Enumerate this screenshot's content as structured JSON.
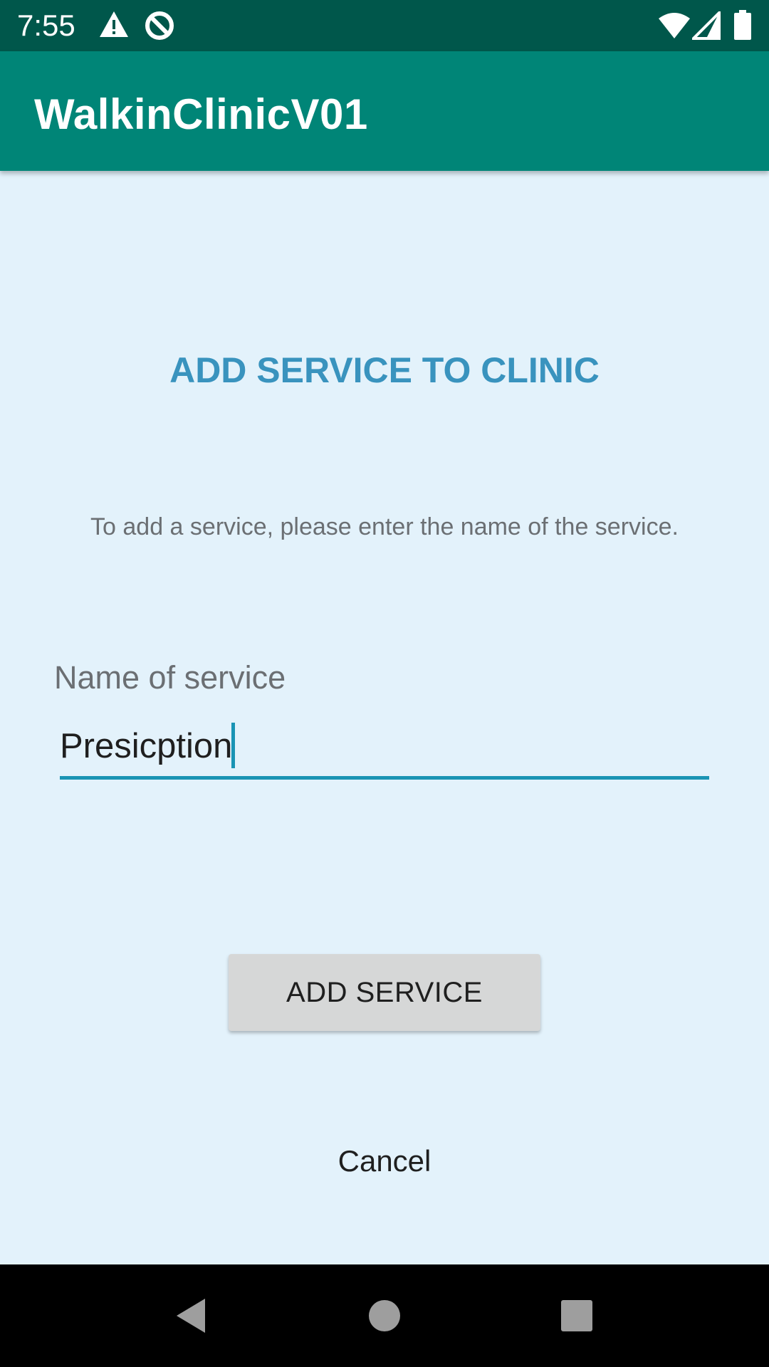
{
  "status_bar": {
    "time": "7:55",
    "icons": [
      "warning-icon",
      "data-saver-icon",
      "wifi-icon",
      "signal-icon",
      "battery-icon"
    ]
  },
  "app_bar": {
    "title": "WalkinClinicV01"
  },
  "main": {
    "title": "ADD SERVICE TO CLINIC",
    "instruction": "To add a service, please enter the name of the service.",
    "service_field": {
      "label": "Name of service",
      "value": "Presicption"
    },
    "add_button_label": "ADD SERVICE",
    "cancel_label": "Cancel"
  },
  "nav_bar": {
    "icons": [
      "back-icon",
      "home-icon",
      "recents-icon"
    ]
  },
  "colors": {
    "status_bar": "#00574b",
    "app_bar": "#008577",
    "background": "#e3f2fb",
    "title": "#3993be",
    "accent": "#1a94b4",
    "button": "#d6d7d7"
  }
}
